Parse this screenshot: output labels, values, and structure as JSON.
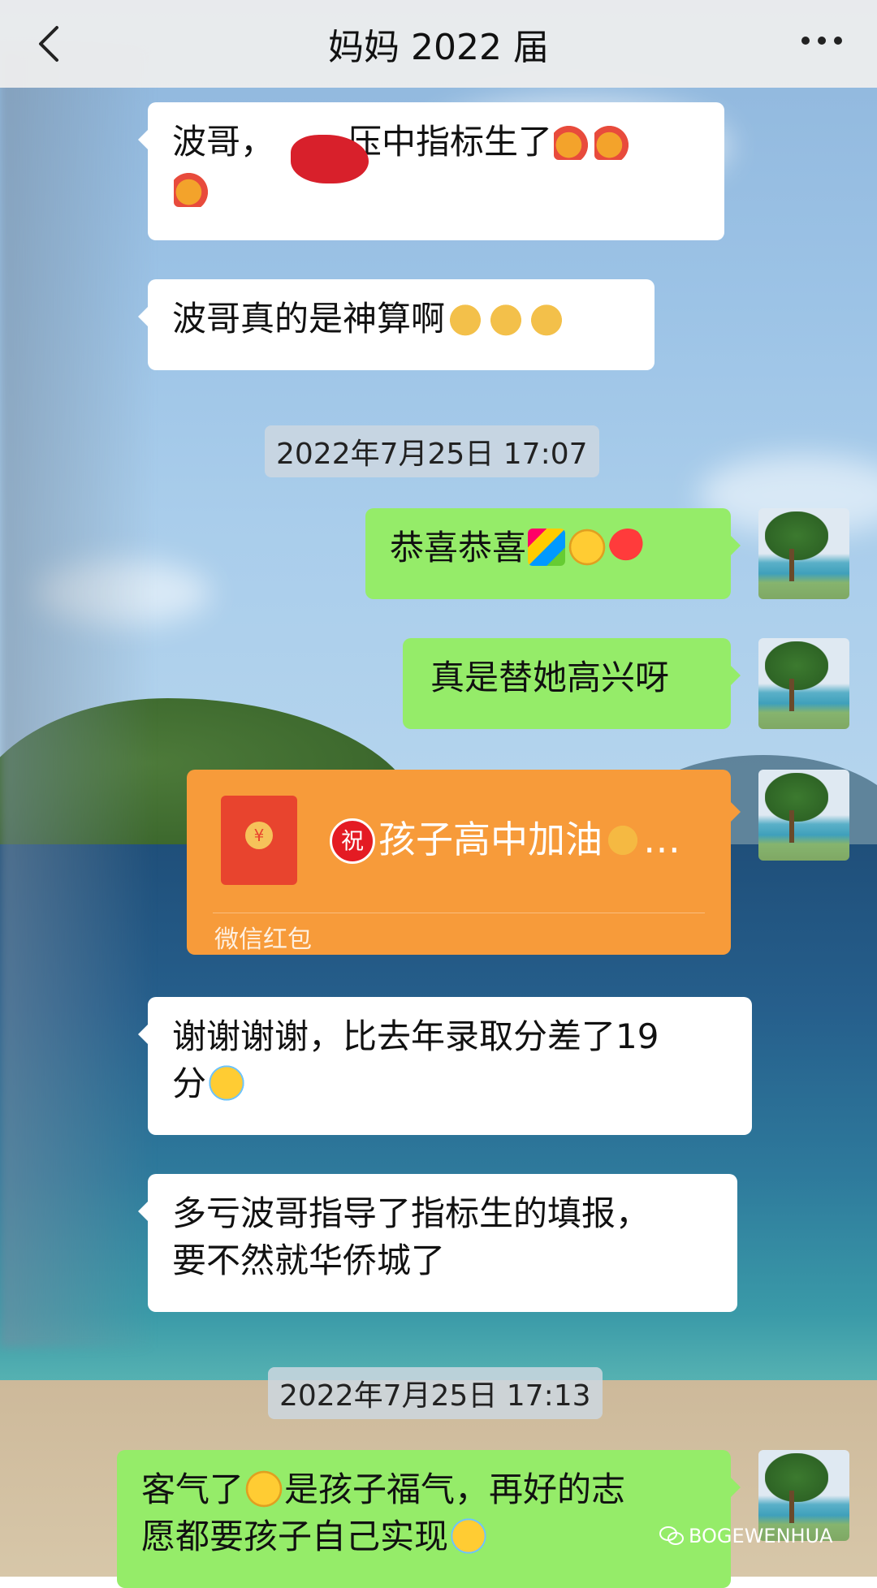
{
  "header": {
    "title": "妈妈 2022 届"
  },
  "messages": [
    {
      "id": "m1",
      "side": "left",
      "text_before": "波哥，",
      "text_after": "压中指标生了",
      "emojis": [
        "party-popper",
        "party-popper",
        "party-popper"
      ]
    },
    {
      "id": "m2",
      "side": "left",
      "text": "波哥真的是神算啊",
      "emojis": [
        "thumbs-up",
        "thumbs-up",
        "thumbs-up"
      ]
    },
    {
      "id": "t1",
      "type": "time",
      "text": "2022年7月25日 17:07"
    },
    {
      "id": "m3",
      "side": "right",
      "text": "恭喜恭喜",
      "emojis": [
        "confetti-ball",
        "grinning-face",
        "balloon"
      ]
    },
    {
      "id": "m4",
      "side": "right",
      "text": "真是替她高兴呀"
    },
    {
      "id": "m5",
      "side": "right",
      "type": "red-packet",
      "text": "孩子高中加油",
      "ellipsis": "…",
      "badge": "祝",
      "label": "微信红包"
    },
    {
      "id": "m6",
      "side": "left",
      "line1": "谢谢谢谢，比去年录取分差了19",
      "line2": "分"
    },
    {
      "id": "m7",
      "side": "left",
      "line1": "多亏波哥指导了指标生的填报，",
      "line2": "要不然就华侨城了"
    },
    {
      "id": "t2",
      "type": "time",
      "text": "2022年7月25日 17:13"
    },
    {
      "id": "m8",
      "side": "right",
      "line1a": "客气了",
      "line1b": "是孩子福气，再好的志",
      "line2": "愿都要孩子自己实现"
    }
  ],
  "watermark": {
    "text": "BOGEWENHUA"
  },
  "colors": {
    "green_bubble": "#95ec69",
    "red_packet": "#f79b3a",
    "header_bg": "#ededed"
  }
}
